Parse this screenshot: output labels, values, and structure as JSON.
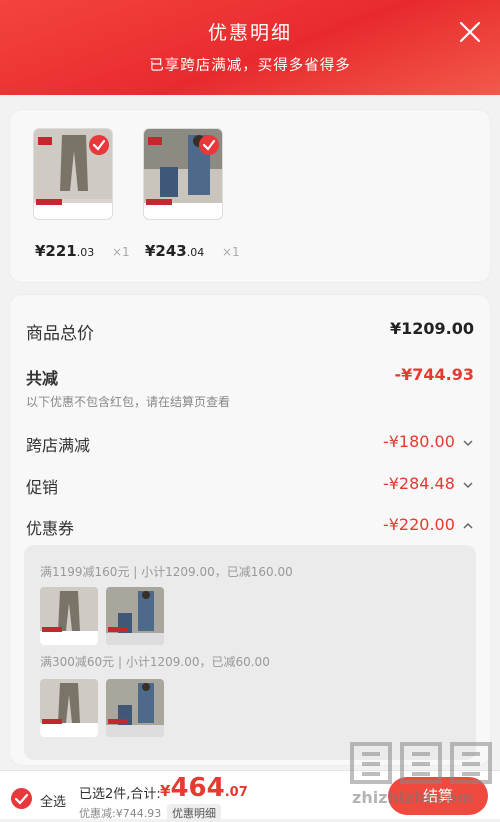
{
  "header": {
    "title": "优惠明细",
    "subtitle": "已享跨店满减，买得多省得多"
  },
  "products": [
    {
      "price_int": "¥221",
      "price_dec": ".03",
      "qty": "×1",
      "badge": "抢先购",
      "price_tag": "358"
    },
    {
      "price_int": "¥243",
      "price_dec": ".04",
      "qty": "×1",
      "badge": "抢先购",
      "price_tag": "398"
    }
  ],
  "summary": {
    "total_label": "商品总价",
    "total_value": "¥1209.00",
    "discount_label": "共减",
    "discount_value": "-¥744.93",
    "note": "以下优惠不包含红包，请在结算页查看",
    "rows": [
      {
        "label": "跨店满减",
        "value": "-¥180.00",
        "chevron": "down"
      },
      {
        "label": "促销",
        "value": "-¥284.48",
        "chevron": "down"
      },
      {
        "label": "优惠券",
        "value": "-¥220.00",
        "chevron": "up"
      }
    ]
  },
  "coupons": [
    {
      "text": "满1199减160元 | 小计1209.00，已减160.00"
    },
    {
      "text": "满300减60元 | 小计1209.00，已减60.00"
    }
  ],
  "bottom": {
    "select_all": "全选",
    "selected_summary": "已选2件,合计:",
    "total_currency": "¥",
    "total_int": "464",
    "total_dec": ".07",
    "discount_note": "优惠减:¥744.93",
    "detail_link": "优惠明细",
    "checkout": "结算"
  },
  "watermark": {
    "domain": "zhizhizhi.com"
  },
  "colors": {
    "accent": "#e53a30",
    "header": "#f0383a"
  }
}
